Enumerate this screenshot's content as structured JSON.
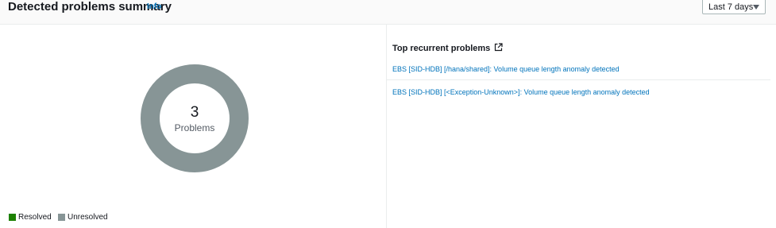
{
  "header": {
    "title": "Detected problems summary",
    "info_label": "Info",
    "time_range": {
      "selected": "Last 7 days"
    }
  },
  "donut": {
    "count": "3",
    "label": "Problems",
    "colors": {
      "resolved": "#1d8102",
      "unresolved": "#879596"
    },
    "chart_data": {
      "type": "pie",
      "series": [
        {
          "name": "Resolved",
          "value": 0
        },
        {
          "name": "Unresolved",
          "value": 3
        }
      ]
    }
  },
  "legend": {
    "items": [
      {
        "label": "Resolved",
        "color": "#1d8102"
      },
      {
        "label": "Unresolved",
        "color": "#879596"
      }
    ]
  },
  "top_recurrent": {
    "title": "Top recurrent problems",
    "icon": "external-link-icon",
    "items": [
      {
        "label": "EBS [SID-HDB] [/hana/shared]: Volume queue length anomaly detected"
      },
      {
        "label": "EBS [SID-HDB] [<Exception-Unknown>]: Volume queue length anomaly detected"
      }
    ]
  }
}
